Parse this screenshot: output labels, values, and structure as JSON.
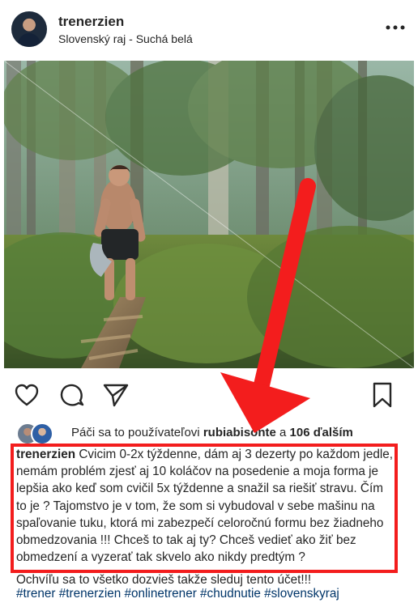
{
  "header": {
    "username": "trenerzien",
    "location": "Slovenský raj - Suchá belá"
  },
  "icons": {
    "more": "more-horizontal-icon",
    "like": "heart-icon",
    "comment": "comment-icon",
    "share": "send-icon",
    "save": "bookmark-icon"
  },
  "likes": {
    "prefix": "Páči sa to používateľovi",
    "user": "rubiabisonte",
    "joiner": "a",
    "others": "106 ďalším"
  },
  "caption": {
    "username": "trenerzien",
    "text": "Cvicim 0-2x týždenne, dám aj 3 dezerty po každom jedle, nemám problém zjesť aj 10 koláčov na posedenie a moja forma je lepšia ako keď som cvičil 5x týždenne a snažil sa riešiť stravu.  Čím to je ? Tajomstvo je v tom, že som si vybudoval v sebe mašinu na spaľovanie tuku, ktorá mi zabezpečí celoročnú formu bez žiadneho obmedzovania !!! Chceš to tak aj ty? Chceš vedieť ako žiť bez obmedzení a vyzerať tak skvelo ako nikdy predtým ?",
    "continued": "Ochvíľu sa to všetko dozvieš takže sleduj tento účet!!!",
    "hashtags": "#trener #trenerzien #onlinetrener #chudnutie #slovenskyraj"
  },
  "colors": {
    "annotation_red": "#f31d1d",
    "text": "#262626",
    "hashtag": "#003569"
  }
}
